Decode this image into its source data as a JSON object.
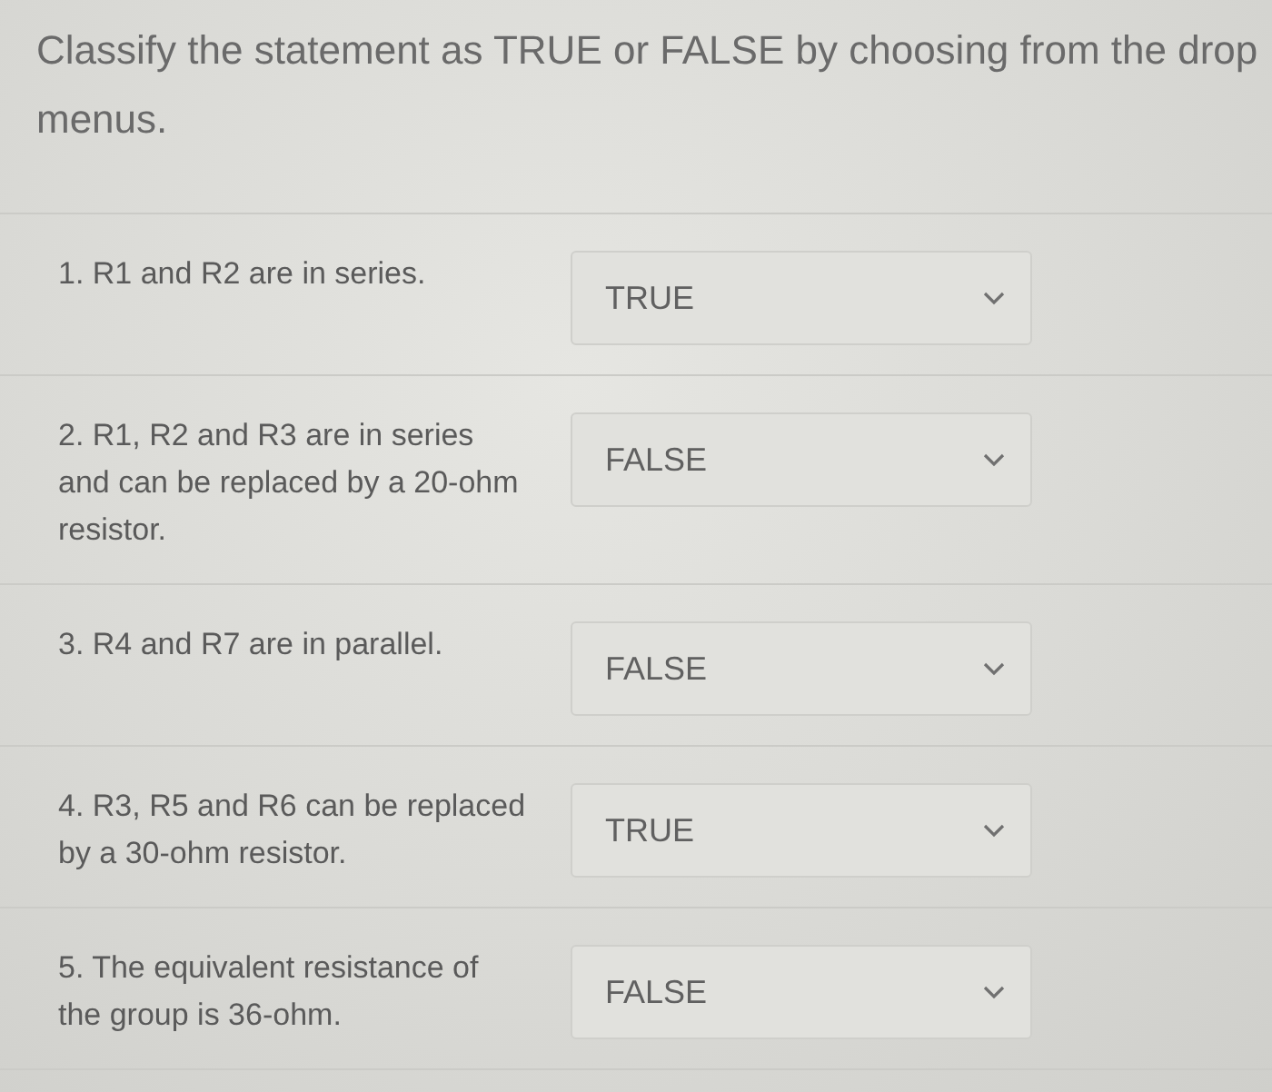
{
  "instructions": "Classify the statement as TRUE or FALSE by choosing from the drop menus.",
  "questions": [
    {
      "statement": "1. R1 and R2 are in series.",
      "answer": "TRUE"
    },
    {
      "statement": "2. R1, R2 and R3 are in series and can be replaced by a 20-ohm resistor.",
      "answer": "FALSE"
    },
    {
      "statement": "3. R4 and R7 are in parallel.",
      "answer": "FALSE"
    },
    {
      "statement": "4. R3, R5 and R6 can be replaced by a 30-ohm resistor.",
      "answer": "TRUE"
    },
    {
      "statement": "5. The equivalent resistance of the group is 36-ohm.",
      "answer": "FALSE"
    }
  ]
}
